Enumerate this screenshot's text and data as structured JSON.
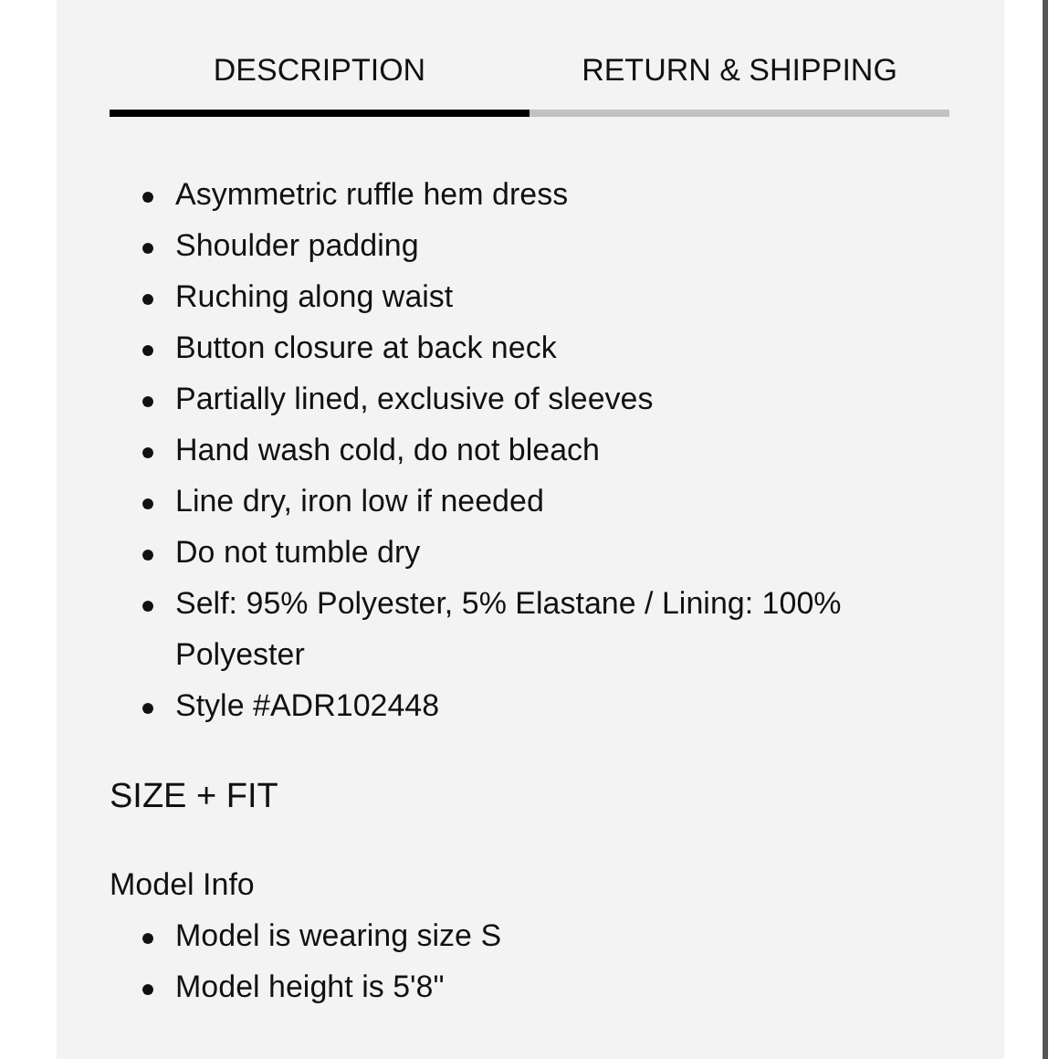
{
  "tabs": [
    {
      "label": "DESCRIPTION",
      "selected": true
    },
    {
      "label": "RETURN & SHIPPING",
      "selected": false
    }
  ],
  "description": [
    "Asymmetric ruffle hem dress",
    "Shoulder padding",
    "Ruching along waist",
    "Button closure at back neck",
    "Partially lined, exclusive of sleeves",
    "Hand wash cold, do not bleach",
    "Line dry, iron low if needed",
    "Do not tumble dry",
    "Self: 95% Polyester, 5% Elastane / Lining: 100% Polyester",
    "Style #ADR102448"
  ],
  "size_fit": {
    "heading": "SIZE + FIT",
    "model_info": {
      "heading": "Model Info",
      "items": [
        "Model is wearing size S",
        "Model height is 5'8\""
      ]
    }
  }
}
